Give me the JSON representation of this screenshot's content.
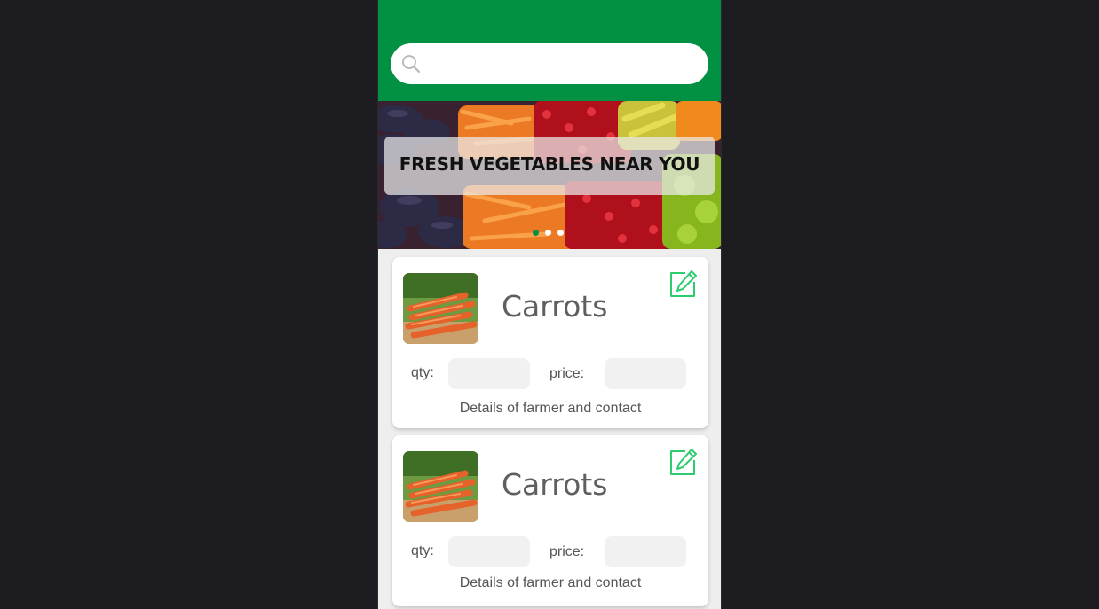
{
  "search": {
    "placeholder": "",
    "icon": "search-icon"
  },
  "banner": {
    "title": "FRESH VEGETABLES NEAR YOU",
    "carousel": {
      "count": 3,
      "active_index": 0
    }
  },
  "products": [
    {
      "name": "Carrots",
      "qty_label": "qty:",
      "qty_value": "",
      "price_label": "price:",
      "price_value": "",
      "details": "Details of farmer and contact",
      "edit_icon": "edit-icon"
    },
    {
      "name": "Carrots",
      "qty_label": "qty:",
      "qty_value": "",
      "price_label": "price:",
      "price_value": "",
      "details": "Details of farmer and contact",
      "edit_icon": "edit-icon"
    }
  ],
  "colors": {
    "primary_green": "#029143",
    "accent_edit": "#2ecc71",
    "background": "#1d1d21",
    "card": "#ffffff",
    "field": "#f1f1f1"
  }
}
